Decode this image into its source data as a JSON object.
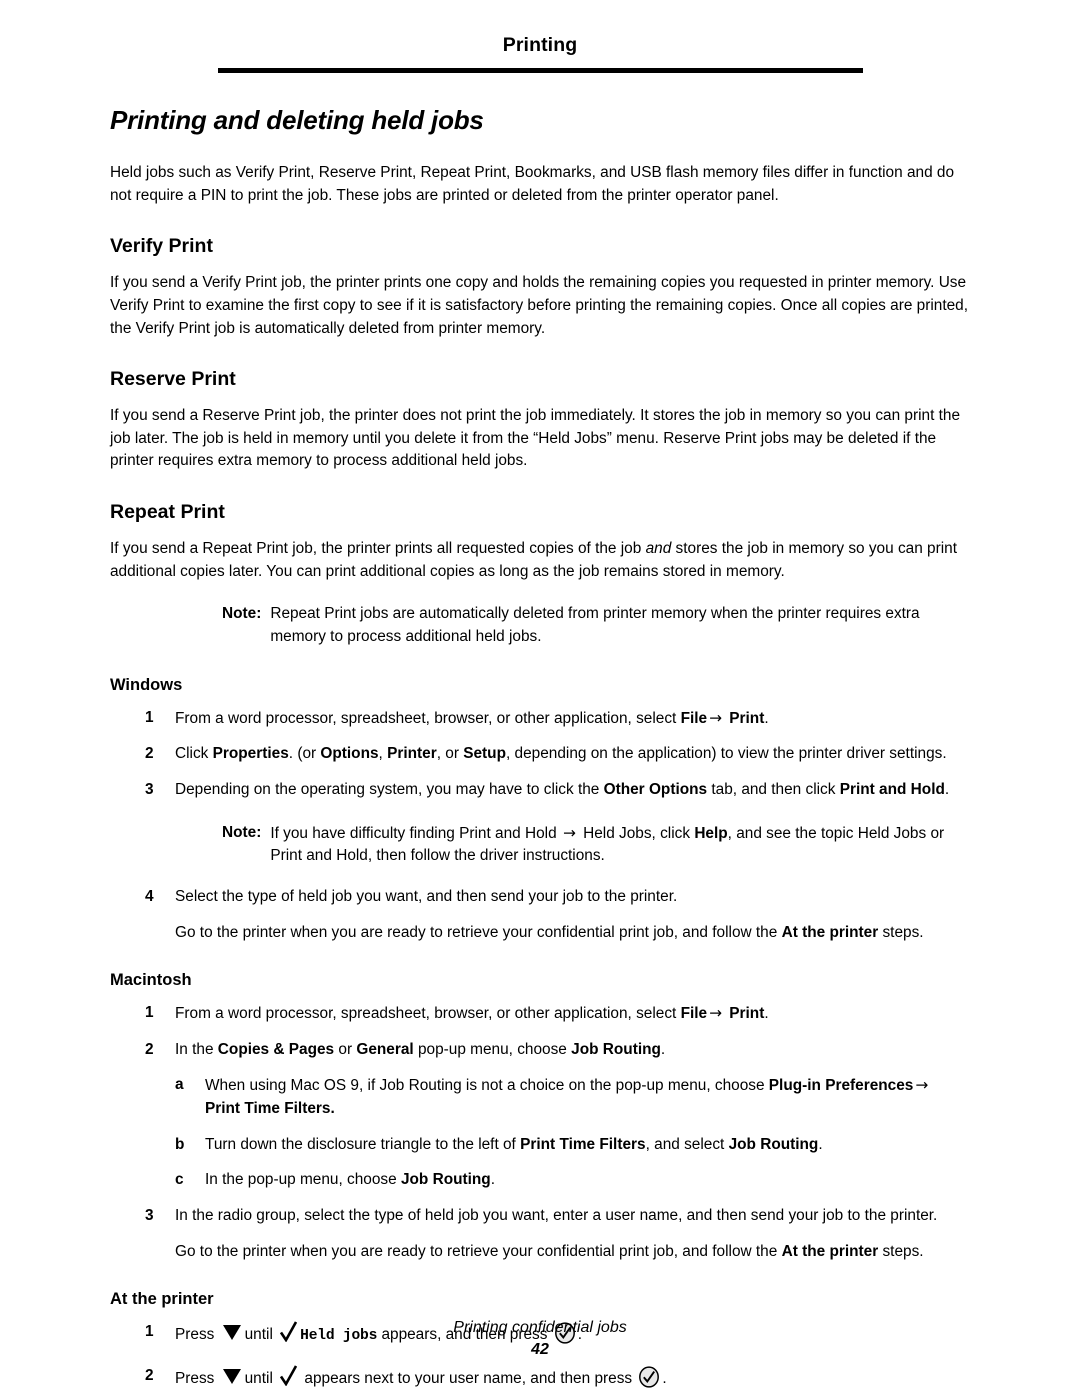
{
  "header": {
    "title": "Printing"
  },
  "doc": {
    "title": "Printing and deleting held jobs",
    "intro": "Held jobs such as Verify Print, Reserve Print, Repeat Print, Bookmarks, and USB flash memory files differ in function and do not require a PIN to print the job. These jobs are printed or deleted from the printer operator panel."
  },
  "verify_print": {
    "heading": "Verify Print",
    "body": "If you send a Verify Print job, the printer prints one copy and holds the remaining copies you requested in printer memory. Use Verify Print to examine the first copy to see if it is satisfactory before printing the remaining copies. Once all copies are printed, the Verify Print job is automatically deleted from printer memory."
  },
  "reserve_print": {
    "heading": "Reserve Print",
    "body": "If you send a Reserve Print job, the printer does not print the job immediately. It stores the job in memory so you can print the job later. The job is held in memory until you delete it from the “Held Jobs” menu. Reserve Print jobs may be deleted if the printer requires extra memory to process additional held jobs."
  },
  "repeat_print": {
    "heading": "Repeat Print",
    "body_1": "If you send a Repeat Print job, the printer prints all requested copies of the job ",
    "body_emphasis": "and",
    "body_2": " stores the job in memory so you can print additional copies later. You can print additional copies as long as the job remains stored in memory.",
    "note_label": "Note:",
    "note_body": "Repeat Print jobs are automatically deleted from printer memory when the printer requires extra memory to process additional held jobs."
  },
  "windows": {
    "heading": "Windows",
    "step1": {
      "num": "1",
      "text_1": "From a word processor, spreadsheet, browser, or other application, select ",
      "bold_1": "File",
      "arrow": "→",
      "bold_2": "Print",
      "text_2": "."
    },
    "step2": {
      "num": "2",
      "text_1": "Click ",
      "bold_1": "Properties",
      "text_2": ". (or ",
      "bold_2": "Options",
      "text_3": ", ",
      "bold_3": "Printer",
      "text_4": ", or ",
      "bold_4": "Setup",
      "text_5": ", depending on the application) to view the printer driver settings."
    },
    "step3": {
      "num": "3",
      "text_1": "Depending on the operating system, you may have to click the ",
      "bold_1": "Other Options",
      "text_2": " tab, and then click ",
      "bold_2": "Print and Hold",
      "text_3": "."
    },
    "note_label": "Note:",
    "note_text_1": "If you have difficulty finding Print and Hold ",
    "note_arrow": "→",
    "note_text_2": " Held Jobs, click ",
    "note_bold": "Help",
    "note_text_3": ", and see the topic Held Jobs or Print and Hold, then follow the driver instructions.",
    "step4": {
      "num": "4",
      "text": "Select the type of held job you want, and then send your job to the printer."
    },
    "followup_1": "Go to the printer when you are ready to retrieve your confidential print job, and follow the ",
    "followup_bold": "At the printer",
    "followup_2": " steps."
  },
  "macintosh": {
    "heading": "Macintosh",
    "step1": {
      "num": "1",
      "text_1": "From a word processor, spreadsheet, browser, or other application, select ",
      "bold_1": "File",
      "arrow": "→",
      "bold_2": "Print",
      "text_2": "."
    },
    "step2": {
      "num": "2",
      "text_1": "In the ",
      "bold_1": "Copies & Pages",
      "text_2": " or ",
      "bold_2": "General",
      "text_3": " pop-up menu, choose ",
      "bold_3": "Job Routing",
      "text_4": "."
    },
    "step_a": {
      "letter": "a",
      "text_1": "When using Mac OS 9, if Job Routing is not a choice on the pop-up menu, choose ",
      "bold_1": "Plug-in Preferences",
      "arrow": "→",
      "bold_2": "Print Time Filters."
    },
    "step_b": {
      "letter": "b",
      "text_1": "Turn down the disclosure triangle to the left of ",
      "bold_1": "Print Time Filters",
      "text_2": ", and select ",
      "bold_2": "Job Routing",
      "text_3": "."
    },
    "step_c": {
      "letter": "c",
      "text_1": "In the pop-up menu, choose ",
      "bold_1": "Job Routing",
      "text_2": "."
    },
    "step3": {
      "num": "3",
      "text": "In the radio group, select the type of held job you want, enter a user name, and then send your job to the printer."
    },
    "followup_1": "Go to the printer when you are ready to retrieve your confidential print job, and follow the ",
    "followup_bold": "At the printer",
    "followup_2": " steps."
  },
  "at_the_printer": {
    "heading": "At the printer",
    "step1": {
      "num": "1",
      "text_1": "Press ",
      "icon_down": "down-arrow-button",
      "text_2": "until ",
      "icon_check": "checkmark",
      "mono": "Held jobs",
      "text_3": " appears, and then press ",
      "icon_select": "select-button",
      "text_4": "."
    },
    "step2": {
      "num": "2",
      "text_1": "Press ",
      "icon_down": "down-arrow-button",
      "text_2": "until ",
      "icon_check": "checkmark",
      "text_3": " appears next to your user name, and then press ",
      "icon_select": "select-button",
      "text_4": "."
    }
  },
  "footer": {
    "text": "Printing confidential jobs",
    "page": "42"
  },
  "colors": {
    "ink": "#000000",
    "paper": "#ffffff",
    "icon_fill": "#e8e8e8"
  }
}
